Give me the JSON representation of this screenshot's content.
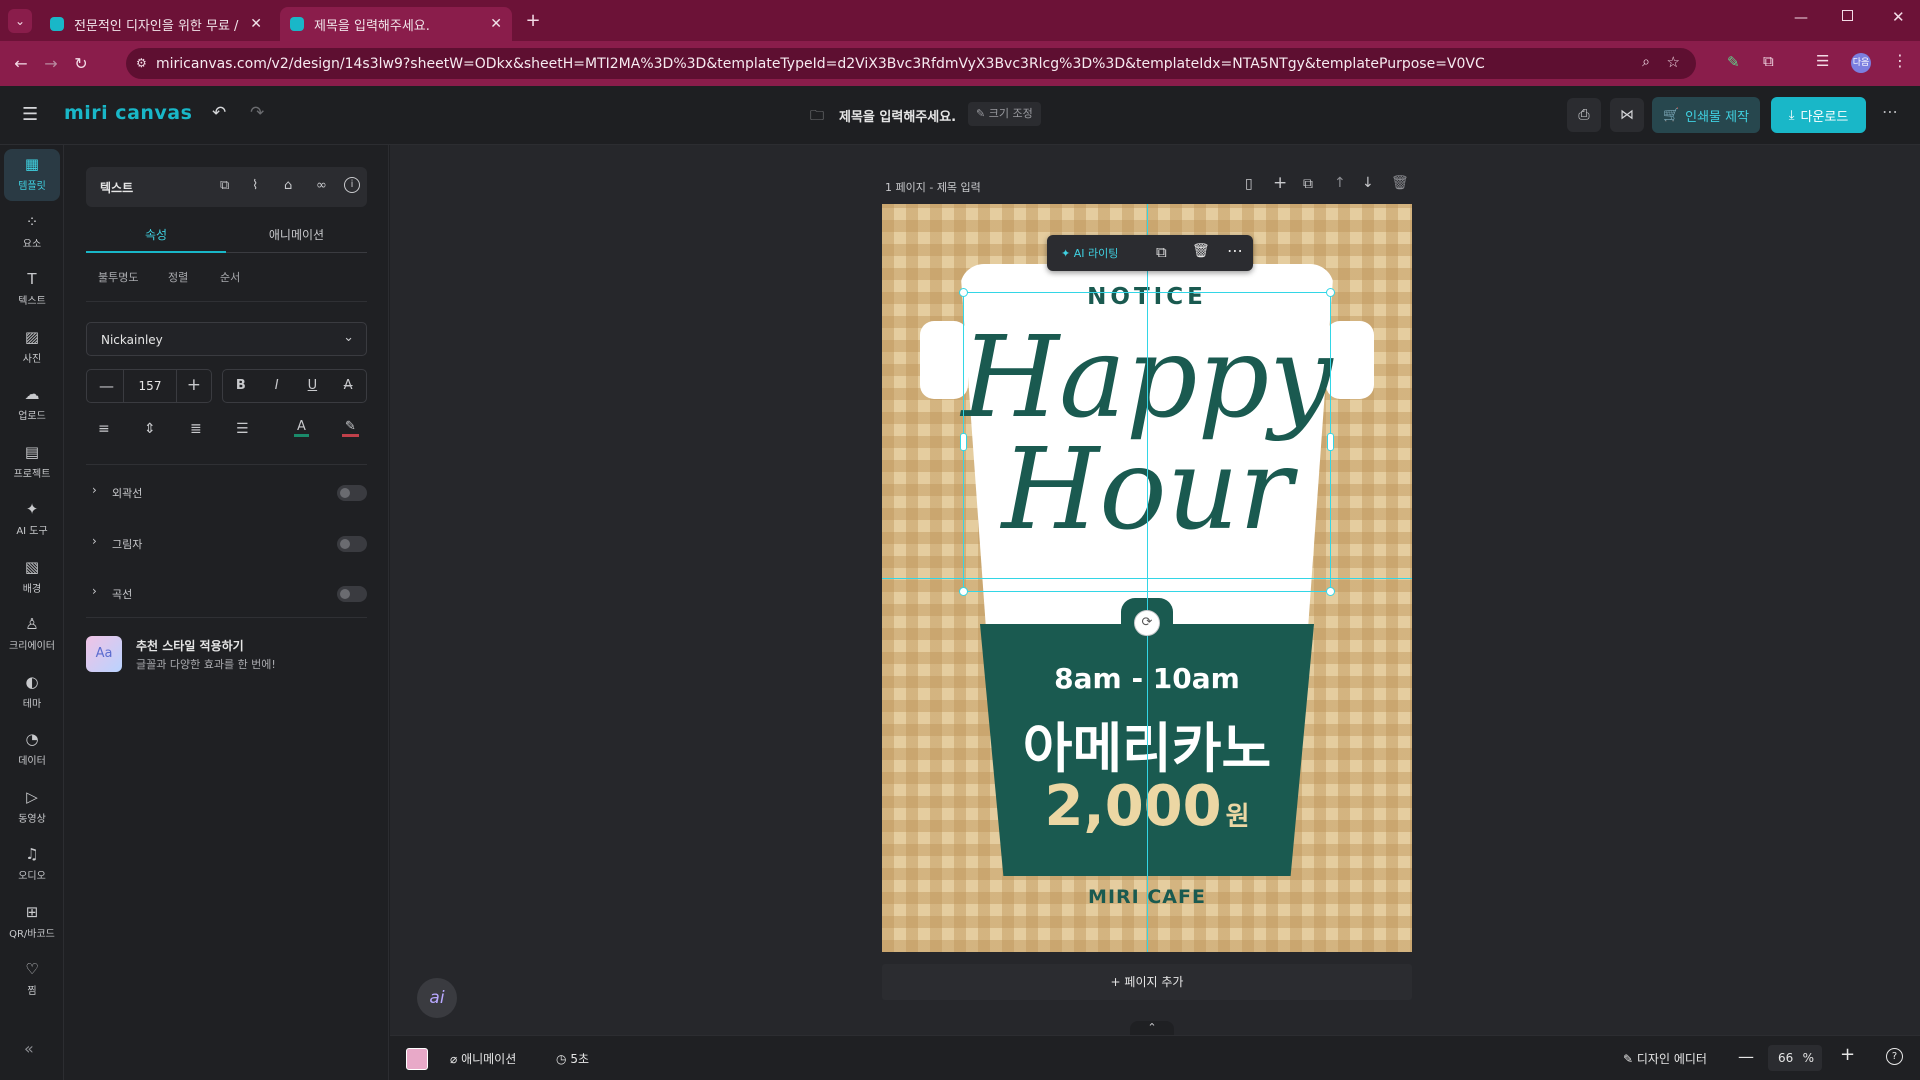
{
  "browser": {
    "tabs": [
      {
        "title": "전문적인 디자인을 위한 무료 /",
        "active": false
      },
      {
        "title": "제목을 입력해주세요.",
        "active": true
      }
    ],
    "url": "miricanvas.com/v2/design/14s3lw9?sheetW=ODkx&sheetH=MTI2MA%3D%3D&templateTypeId=d2ViX3Bvc3RfdmVyX3Bvc3Rlcg%3D%3D&templateIdx=NTA5NTgy&templatePurpose=V0VC",
    "profile": "다음"
  },
  "app": {
    "logo": "miri canvas",
    "doc_title": "제목을 입력해주세요.",
    "resize_label": "크기 조정",
    "print_label": "인쇄물 제작",
    "download_label": "다운로드"
  },
  "sidebar": {
    "items": [
      {
        "label": "템플릿",
        "icon": "template-icon"
      },
      {
        "label": "요소",
        "icon": "elements-icon"
      },
      {
        "label": "텍스트",
        "icon": "text-icon"
      },
      {
        "label": "사진",
        "icon": "photo-icon"
      },
      {
        "label": "업로드",
        "icon": "upload-icon"
      },
      {
        "label": "프로젝트",
        "icon": "project-icon"
      },
      {
        "label": "AI 도구",
        "icon": "ai-tool-icon"
      },
      {
        "label": "배경",
        "icon": "background-icon"
      },
      {
        "label": "크리에이터",
        "icon": "creator-icon"
      },
      {
        "label": "테마",
        "icon": "theme-icon"
      },
      {
        "label": "데이터",
        "icon": "data-icon"
      },
      {
        "label": "동영상",
        "icon": "video-icon"
      },
      {
        "label": "오디오",
        "icon": "audio-icon"
      },
      {
        "label": "QR/바코드",
        "icon": "qr-icon"
      },
      {
        "label": "찜",
        "icon": "heart-icon"
      }
    ]
  },
  "panel": {
    "header": "텍스트",
    "tabs": [
      "속성",
      "애니메이션"
    ],
    "subtabs": [
      "불투명도",
      "정렬",
      "순서"
    ],
    "font": "Nickainley",
    "font_size": "157",
    "sections": [
      "외곽선",
      "그림자",
      "곡선"
    ],
    "recommend_title": "추천 스타일 적용하기",
    "recommend_sub": "글꼴과 다양한 효과를 한 번에!",
    "recommend_badge": "Aa"
  },
  "canvas": {
    "page_label": "1 페이지 - 제목 입력",
    "ai_writing": "AI 라이팅",
    "add_page": "페이지 추가",
    "poster": {
      "notice": "NOTICE",
      "title_line1": "Happy",
      "title_line2": "Hour",
      "time": "8am - 10am",
      "item": "아메리카노",
      "price": "2,000",
      "currency": "원",
      "cafe": "MIRI CAFE"
    }
  },
  "bottom": {
    "animation": "애니메이션",
    "duration": "5초",
    "design_editor": "디자인 에디터",
    "zoom": "66",
    "zoom_unit": "%"
  },
  "colors": {
    "accent": "#19b7c8",
    "browser": "#8a1d4b",
    "poster_green": "#1a5a50",
    "poster_cream": "#e5cd9f"
  }
}
